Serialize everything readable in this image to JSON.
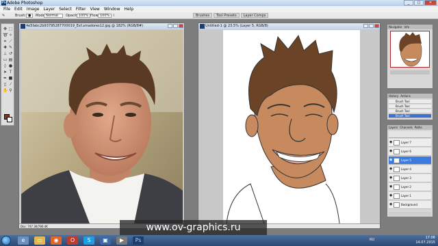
{
  "app": {
    "title": "Adobe Photoshop"
  },
  "menu": [
    "File",
    "Edit",
    "Image",
    "Layer",
    "Select",
    "Filter",
    "View",
    "Window",
    "Help"
  ],
  "options": {
    "brush_label": "Brush:",
    "mode_label": "Mode:",
    "mode_value": "Normal",
    "opacity_label": "Opacity:",
    "opacity_value": "100%",
    "flow_label": "Flow:",
    "flow_value": "100%"
  },
  "panel_tabs": [
    "Brushes",
    "Tool Presets",
    "Layer Comps"
  ],
  "doc_photo": {
    "title": "4e5fabc2b93795287700019_Exf.umadores12.jpg @ 182% (RGB/8#)",
    "status": "Doc: 747.3K/780.4K"
  },
  "doc_drawing": {
    "title": "Untitled-1 @ 23.5% (Layer 5, RGB/8)",
    "status": ""
  },
  "navigator": {
    "tabs": [
      "Navigator",
      "Info"
    ]
  },
  "history": {
    "tabs": [
      "History",
      "Actions"
    ],
    "items": [
      "Brush Tool",
      "Brush Tool",
      "Brush Tool",
      "Brush Tool"
    ]
  },
  "layers": {
    "tabs": [
      "Layers",
      "Channels",
      "Paths"
    ],
    "items": [
      "Layer 7",
      "Layer 6",
      "Layer 5",
      "Layer 4",
      "Layer 3",
      "Layer 2",
      "Layer 1",
      "Background"
    ],
    "selected_index": 2
  },
  "watermark": "www.ov-graphics.ru",
  "taskbar": {
    "lang": "RU",
    "time": "17:06",
    "date": "14.07.2015"
  }
}
